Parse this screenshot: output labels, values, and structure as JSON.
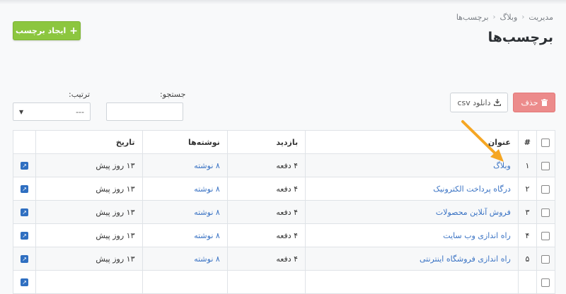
{
  "breadcrumb": [
    "مدیریت",
    "وبلاگ",
    "برچسب‌ها"
  ],
  "page_title": "برچسب‌ها",
  "create_button": "ایجاد برچسب",
  "filters": {
    "sort_label": "ترتیب:",
    "sort_value": "---",
    "search_label": "جستجو:",
    "search_value": ""
  },
  "actions": {
    "delete": "حذف",
    "csv": "دانلود csv"
  },
  "table": {
    "headers": {
      "num": "#",
      "title": "عنوان",
      "visits": "بازدید",
      "posts": "نوشته‌ها",
      "date": "تاریخ"
    },
    "rows": [
      {
        "num": "۱",
        "title": "وبلاگ",
        "visits": "۴ دفعه",
        "posts": "۸ نوشته",
        "date": "۱۳ روز پیش"
      },
      {
        "num": "۲",
        "title": "درگاه پرداخت الکترونیک",
        "visits": "۴ دفعه",
        "posts": "۸ نوشته",
        "date": "۱۳ روز پیش"
      },
      {
        "num": "۳",
        "title": "فروش آنلاین محصولات",
        "visits": "۴ دفعه",
        "posts": "۸ نوشته",
        "date": "۱۳ روز پیش"
      },
      {
        "num": "۴",
        "title": "راه اندازی وب سایت",
        "visits": "۴ دفعه",
        "posts": "۸ نوشته",
        "date": "۱۳ روز پیش"
      },
      {
        "num": "۵",
        "title": "راه اندازی فروشگاه اینترنتی",
        "visits": "۴ دفعه",
        "posts": "۸ نوشته",
        "date": "۱۳ روز پیش"
      },
      {
        "num": "",
        "title": "",
        "visits": "",
        "posts": "",
        "date": ""
      }
    ]
  },
  "colors": {
    "accent_green": "#8cc63f",
    "danger": "#ec8b8b",
    "link": "#3a73c4",
    "annotation_arrow": "#f5a623"
  },
  "icons": {
    "create": "plus-icon",
    "delete": "trash-icon",
    "csv": "download-icon",
    "row_action": "edit-icon"
  }
}
